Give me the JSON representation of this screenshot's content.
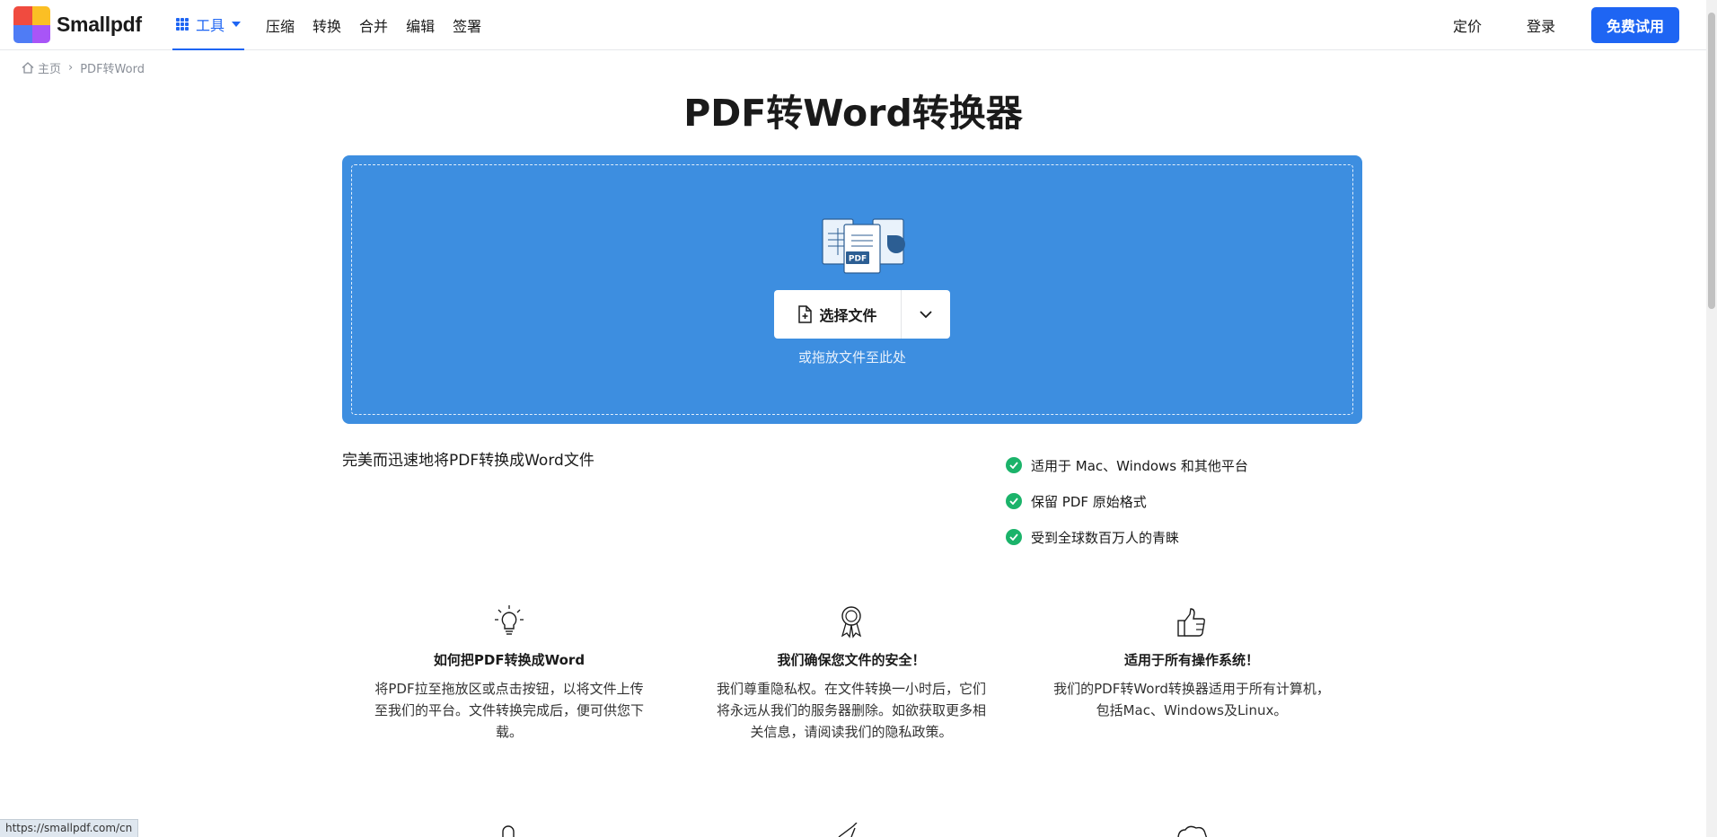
{
  "header": {
    "logo_text": "Smallpdf",
    "logo_colors": [
      "#ef4444",
      "#f59e0b",
      "#3b82f6",
      "#22c55e"
    ],
    "nav": {
      "tools_label": "工具",
      "items": [
        "压缩",
        "转换",
        "合并",
        "编辑",
        "签署"
      ]
    },
    "pricing_label": "定价",
    "login_label": "登录",
    "trial_label": "免费试用",
    "accent_color": "#1e65f3"
  },
  "breadcrumb": {
    "home_label": "主页",
    "current_label": "PDF转Word"
  },
  "page_title": "PDF转Word转换器",
  "dropzone": {
    "background_color": "#3d8ee0",
    "choose_label": "选择文件",
    "drop_hint": "或拖放文件至此处",
    "pdf_badge": "PDF"
  },
  "subtitle": "完美而迅速地将PDF转换成Word文件",
  "features": [
    "适用于 Mac、Windows 和其他平台",
    "保留 PDF 原始格式",
    "受到全球数百万人的青睐"
  ],
  "columns": [
    {
      "icon": "lightbulb-icon",
      "title": "如何把PDF转换成Word",
      "text": "将PDF拉至拖放区或点击按钮，以将文件上传至我们的平台。文件转换完成后，便可供您下载。"
    },
    {
      "icon": "award-icon",
      "title": "我们确保您文件的安全！",
      "text": "我们尊重隐私权。在文件转换一小时后，它们将永远从我们的服务器删除。如欲获取更多相关信息，请阅读我们的隐私政策。"
    },
    {
      "icon": "thumbs-up-icon",
      "title": "适用于所有操作系统！",
      "text": "我们的PDF转Word转换器适用于所有计算机，包括Mac、Windows及Linux。"
    }
  ],
  "status_bar_url": "https://smallpdf.com/cn"
}
